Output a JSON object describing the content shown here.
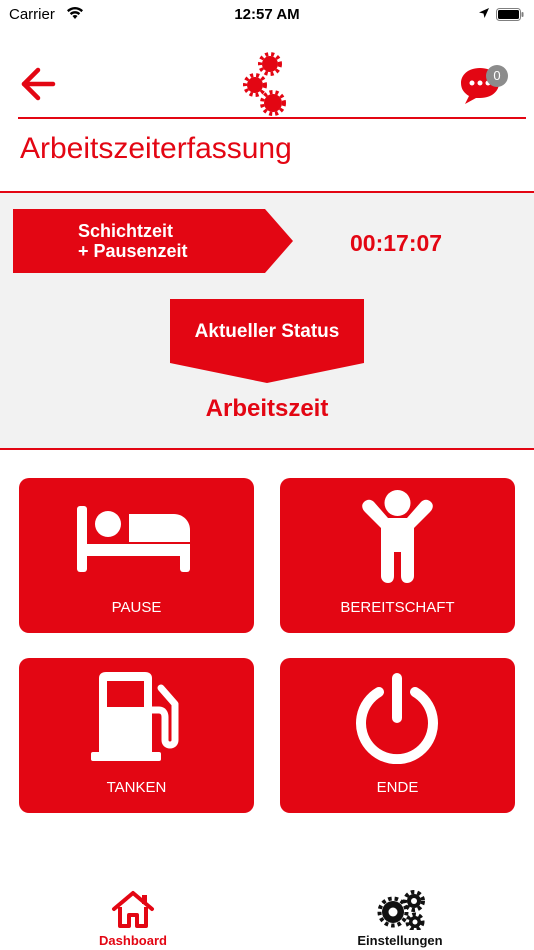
{
  "statusbar": {
    "carrier": "Carrier",
    "time": "12:57 AM"
  },
  "header": {
    "badge_count": "0"
  },
  "page": {
    "title": "Arbeitszeiterfassung"
  },
  "shift": {
    "label_line1": "Schichtzeit",
    "label_line2": "+ Pausenzeit",
    "elapsed": "00:17:07"
  },
  "status": {
    "label": "Aktueller Status",
    "value": "Arbeitszeit"
  },
  "actions": [
    {
      "label": "PAUSE",
      "icon": "bed-icon"
    },
    {
      "label": "BEREITSCHAFT",
      "icon": "person-arms-up-icon"
    },
    {
      "label": "TANKEN",
      "icon": "fuel-pump-icon"
    },
    {
      "label": "ENDE",
      "icon": "power-icon"
    }
  ],
  "tabs": [
    {
      "label": "Dashboard",
      "icon": "home-icon"
    },
    {
      "label": "Einstellungen",
      "icon": "gears-icon"
    }
  ],
  "colors": {
    "brand": "#e30613",
    "panel": "#f2f2f2",
    "badge": "#8c8c8c"
  }
}
